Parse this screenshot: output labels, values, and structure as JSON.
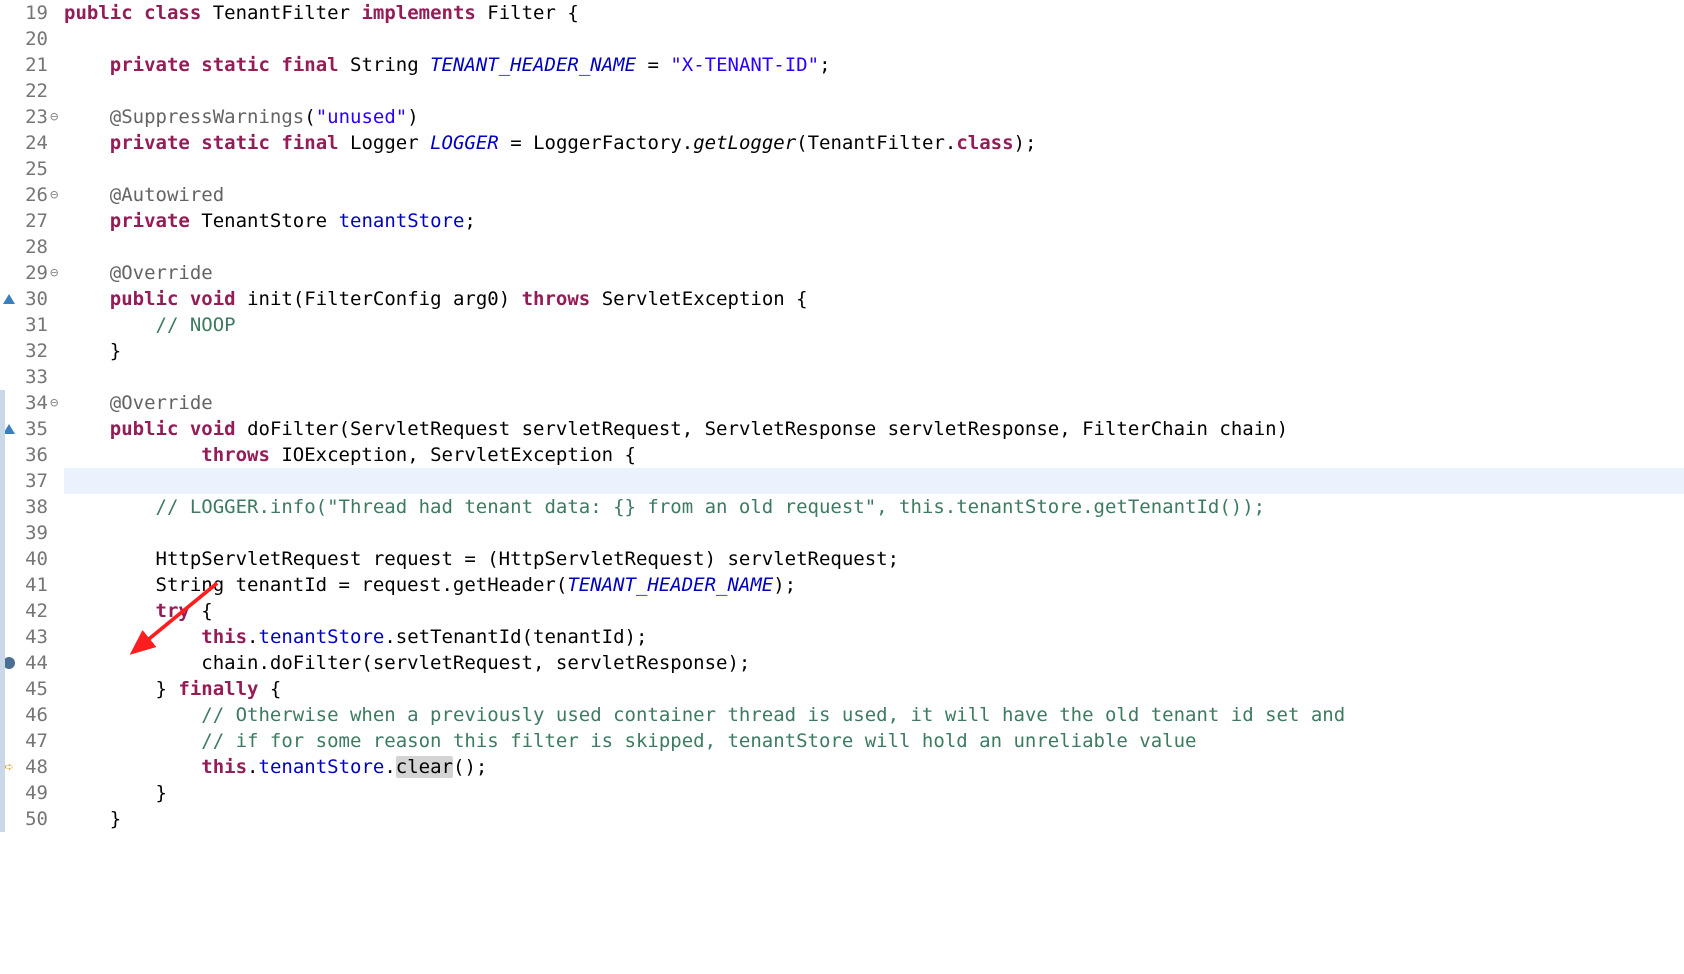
{
  "gutter": {
    "lines": [
      {
        "n": "19",
        "fold": "",
        "marker": "",
        "diff": false
      },
      {
        "n": "20",
        "fold": "",
        "marker": "",
        "diff": false
      },
      {
        "n": "21",
        "fold": "",
        "marker": "",
        "diff": false
      },
      {
        "n": "22",
        "fold": "",
        "marker": "",
        "diff": false
      },
      {
        "n": "23",
        "fold": "⊖",
        "marker": "",
        "diff": false
      },
      {
        "n": "24",
        "fold": "",
        "marker": "",
        "diff": false
      },
      {
        "n": "25",
        "fold": "",
        "marker": "",
        "diff": false
      },
      {
        "n": "26",
        "fold": "⊖",
        "marker": "",
        "diff": false
      },
      {
        "n": "27",
        "fold": "",
        "marker": "",
        "diff": false
      },
      {
        "n": "28",
        "fold": "",
        "marker": "",
        "diff": false
      },
      {
        "n": "29",
        "fold": "⊖",
        "marker": "",
        "diff": false
      },
      {
        "n": "30",
        "fold": "",
        "marker": "warn",
        "diff": false
      },
      {
        "n": "31",
        "fold": "",
        "marker": "",
        "diff": false
      },
      {
        "n": "32",
        "fold": "",
        "marker": "",
        "diff": false
      },
      {
        "n": "33",
        "fold": "",
        "marker": "",
        "diff": false
      },
      {
        "n": "34",
        "fold": "⊖",
        "marker": "",
        "diff": true
      },
      {
        "n": "35",
        "fold": "",
        "marker": "warn",
        "diff": true
      },
      {
        "n": "36",
        "fold": "",
        "marker": "",
        "diff": true
      },
      {
        "n": "37",
        "fold": "",
        "marker": "",
        "diff": true,
        "hl": true
      },
      {
        "n": "38",
        "fold": "",
        "marker": "",
        "diff": true
      },
      {
        "n": "39",
        "fold": "",
        "marker": "",
        "diff": true
      },
      {
        "n": "40",
        "fold": "",
        "marker": "",
        "diff": true
      },
      {
        "n": "41",
        "fold": "",
        "marker": "",
        "diff": true
      },
      {
        "n": "42",
        "fold": "",
        "marker": "",
        "diff": true
      },
      {
        "n": "43",
        "fold": "",
        "marker": "",
        "diff": true
      },
      {
        "n": "44",
        "fold": "",
        "marker": "bp",
        "diff": true
      },
      {
        "n": "45",
        "fold": "",
        "marker": "",
        "diff": true
      },
      {
        "n": "46",
        "fold": "",
        "marker": "",
        "diff": true
      },
      {
        "n": "47",
        "fold": "",
        "marker": "",
        "diff": true
      },
      {
        "n": "48",
        "fold": "",
        "marker": "ip",
        "diff": true
      },
      {
        "n": "49",
        "fold": "",
        "marker": "",
        "diff": true
      },
      {
        "n": "50",
        "fold": "",
        "marker": "",
        "diff": true
      }
    ]
  },
  "code": {
    "lines": [
      [
        {
          "c": "kw",
          "t": "public"
        },
        {
          "t": " "
        },
        {
          "c": "kw",
          "t": "class"
        },
        {
          "t": " TenantFilter "
        },
        {
          "c": "kw",
          "t": "implements"
        },
        {
          "t": " Filter {"
        }
      ],
      [],
      [
        {
          "t": "    "
        },
        {
          "c": "kw",
          "t": "private"
        },
        {
          "t": " "
        },
        {
          "c": "kw",
          "t": "static"
        },
        {
          "t": " "
        },
        {
          "c": "kw",
          "t": "final"
        },
        {
          "t": " String "
        },
        {
          "c": "id-it",
          "t": "TENANT_HEADER_NAME"
        },
        {
          "t": " = "
        },
        {
          "c": "str",
          "t": "\"X-TENANT-ID\""
        },
        {
          "t": ";"
        }
      ],
      [],
      [
        {
          "t": "    "
        },
        {
          "c": "ann",
          "t": "@SuppressWarnings"
        },
        {
          "t": "("
        },
        {
          "c": "str",
          "t": "\"unused\""
        },
        {
          "t": ")"
        }
      ],
      [
        {
          "t": "    "
        },
        {
          "c": "kw",
          "t": "private"
        },
        {
          "t": " "
        },
        {
          "c": "kw",
          "t": "static"
        },
        {
          "t": " "
        },
        {
          "c": "kw",
          "t": "final"
        },
        {
          "t": " Logger "
        },
        {
          "c": "id-it",
          "t": "LOGGER"
        },
        {
          "t": " = LoggerFactory."
        },
        {
          "c": "mref",
          "t": "getLogger"
        },
        {
          "t": "(TenantFilter."
        },
        {
          "c": "kw",
          "t": "class"
        },
        {
          "t": ");"
        }
      ],
      [],
      [
        {
          "t": "    "
        },
        {
          "c": "ann",
          "t": "@Autowired"
        }
      ],
      [
        {
          "t": "    "
        },
        {
          "c": "kw",
          "t": "private"
        },
        {
          "t": " TenantStore "
        },
        {
          "c": "id-f",
          "t": "tenantStore"
        },
        {
          "t": ";"
        }
      ],
      [],
      [
        {
          "t": "    "
        },
        {
          "c": "ann",
          "t": "@Override"
        }
      ],
      [
        {
          "t": "    "
        },
        {
          "c": "kw",
          "t": "public"
        },
        {
          "t": " "
        },
        {
          "c": "kw",
          "t": "void"
        },
        {
          "t": " init(FilterConfig arg0) "
        },
        {
          "c": "kw",
          "t": "throws"
        },
        {
          "t": " ServletException {"
        }
      ],
      [
        {
          "t": "        "
        },
        {
          "c": "cm",
          "t": "// NOOP"
        }
      ],
      [
        {
          "t": "    }"
        }
      ],
      [],
      [
        {
          "t": "    "
        },
        {
          "c": "ann",
          "t": "@Override"
        }
      ],
      [
        {
          "t": "    "
        },
        {
          "c": "kw",
          "t": "public"
        },
        {
          "t": " "
        },
        {
          "c": "kw",
          "t": "void"
        },
        {
          "t": " doFilter(ServletRequest servletRequest, ServletResponse servletResponse, FilterChain chain)"
        }
      ],
      [
        {
          "t": "            "
        },
        {
          "c": "kw",
          "t": "throws"
        },
        {
          "t": " IOException, ServletException {"
        }
      ],
      [],
      [
        {
          "t": "        "
        },
        {
          "c": "cm",
          "t": "// LOGGER.info(\"Thread had tenant data: {} from an old request\", this.tenantStore.getTenantId());"
        }
      ],
      [],
      [
        {
          "t": "        HttpServletRequest request = (HttpServletRequest) servletRequest;"
        }
      ],
      [
        {
          "t": "        String tenantId = request.getHeader("
        },
        {
          "c": "id-it",
          "t": "TENANT_HEADER_NAME"
        },
        {
          "t": ");"
        }
      ],
      [
        {
          "t": "        "
        },
        {
          "c": "kw",
          "t": "try"
        },
        {
          "t": " {"
        }
      ],
      [
        {
          "t": "            "
        },
        {
          "c": "kw",
          "t": "this"
        },
        {
          "t": "."
        },
        {
          "c": "id-f",
          "t": "tenantStore"
        },
        {
          "t": ".setTenantId(tenantId);"
        }
      ],
      [
        {
          "t": "            chain.doFilter(servletRequest, servletResponse);"
        }
      ],
      [
        {
          "t": "        } "
        },
        {
          "c": "kw",
          "t": "finally"
        },
        {
          "t": " {"
        }
      ],
      [
        {
          "t": "            "
        },
        {
          "c": "cm",
          "t": "// Otherwise when a previously used container thread is used, it will have the old tenant id set and"
        }
      ],
      [
        {
          "t": "            "
        },
        {
          "c": "cm",
          "t": "// if for some reason this filter is skipped, tenantStore will hold an unreliable value"
        }
      ],
      [
        {
          "t": "            "
        },
        {
          "c": "kw",
          "t": "this"
        },
        {
          "t": "."
        },
        {
          "c": "id-f",
          "t": "tenantStore"
        },
        {
          "t": "."
        },
        {
          "c": "occ",
          "t": "clear"
        },
        {
          "t": "();"
        }
      ],
      [
        {
          "t": "        }"
        }
      ],
      [
        {
          "t": "    }"
        }
      ]
    ]
  }
}
